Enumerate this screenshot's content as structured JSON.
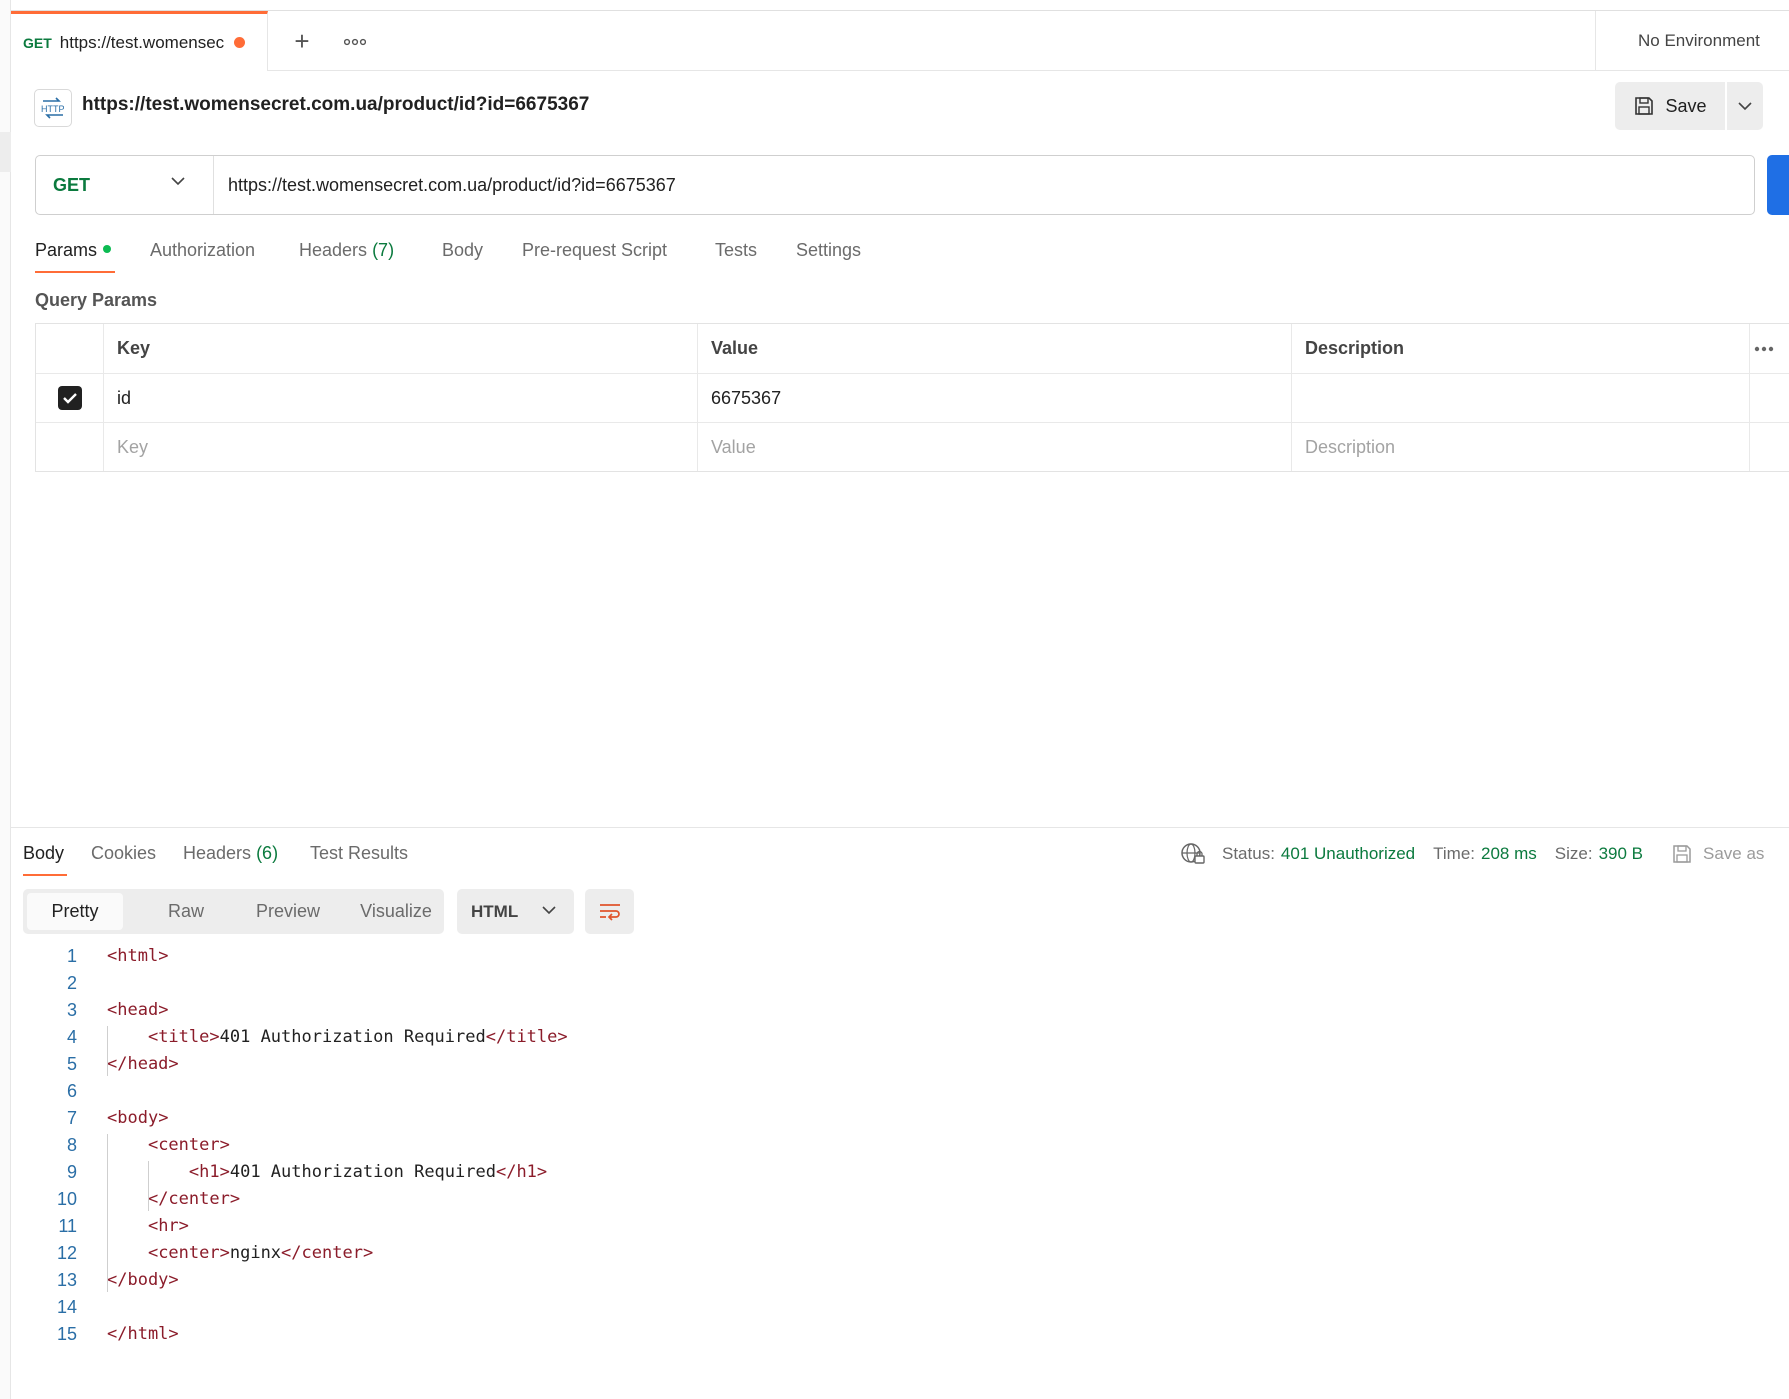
{
  "tab": {
    "method": "GET",
    "title": "https://test.womensec",
    "new_tab": "+",
    "more": "⋯"
  },
  "environment": "No Environment",
  "request": {
    "title": "https://test.womensecret.com.ua/product/id?id=6675367",
    "method": "GET",
    "url": "https://test.womensecret.com.ua/product/id?id=6675367",
    "save_label": "Save"
  },
  "request_tabs": {
    "params": "Params",
    "authorization": "Authorization",
    "headers": "Headers",
    "headers_count": "(7)",
    "body": "Body",
    "pre_request": "Pre-request Script",
    "tests": "Tests",
    "settings": "Settings"
  },
  "query_params": {
    "label": "Query Params",
    "columns": [
      "Key",
      "Value",
      "Description"
    ],
    "more": "···",
    "rows": [
      {
        "checked": true,
        "key": "id",
        "value": "6675367",
        "description": ""
      }
    ],
    "placeholder": {
      "key": "Key",
      "value": "Value",
      "description": "Description"
    }
  },
  "response": {
    "tabs": {
      "body": "Body",
      "cookies": "Cookies",
      "headers": "Headers",
      "headers_count": "(6)",
      "test_results": "Test Results"
    },
    "status_label": "Status:",
    "status_value": "401 Unauthorized",
    "time_label": "Time:",
    "time_value": "208 ms",
    "size_label": "Size:",
    "size_value": "390 B",
    "save_as": "Save as",
    "views": [
      "Pretty",
      "Raw",
      "Preview",
      "Visualize"
    ],
    "format": "HTML"
  },
  "code_lines": [
    "<html>",
    "",
    "<head>",
    "    <title>401 Authorization Required</title>",
    "</head>",
    "",
    "<body>",
    "    <center>",
    "        <h1>401 Authorization Required</h1>",
    "    </center>",
    "    <hr>",
    "    <center>nginx</center>",
    "</body>",
    "",
    "</html>"
  ],
  "colors": {
    "accent": "#ff6c37",
    "method_get": "#0b7a3e",
    "send_button": "#1f6fe5",
    "tag": "#8b1c2a",
    "line_number": "#2a6ea6"
  }
}
